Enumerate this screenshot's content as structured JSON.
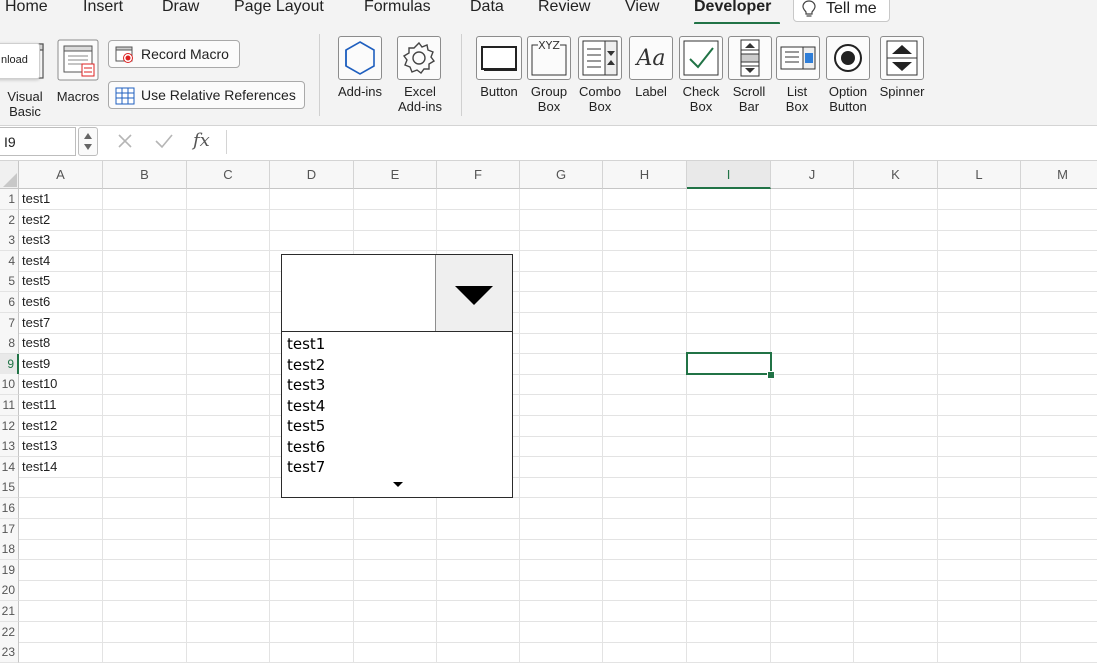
{
  "menu": {
    "tabs": [
      {
        "label": "Home",
        "active": false
      },
      {
        "label": "Insert",
        "active": false
      },
      {
        "label": "Draw",
        "active": false
      },
      {
        "label": "Page Layout",
        "active": false
      },
      {
        "label": "Formulas",
        "active": false
      },
      {
        "label": "Data",
        "active": false
      },
      {
        "label": "Review",
        "active": false
      },
      {
        "label": "View",
        "active": false
      },
      {
        "label": "Developer",
        "active": true
      }
    ],
    "tell_me": "Tell me"
  },
  "tooltip_text": "nload",
  "ribbon": {
    "visual_basic": "Visual\nBasic",
    "macros": "Macros",
    "record_macro": "Record Macro",
    "use_relative_references": "Use Relative References",
    "add_ins": "Add-ins",
    "excel_add_ins": "Excel\nAdd-ins",
    "button": "Button",
    "group_box": "Group\nBox",
    "combo_box": "Combo\nBox",
    "label": "Label",
    "check_box": "Check\nBox",
    "scroll_bar": "Scroll\nBar",
    "list_box": "List\nBox",
    "option_button": "Option\nButton",
    "spinner": "Spinner",
    "group_box_icon_text": "XYZ",
    "label_icon_text": "Aa"
  },
  "formula_bar": {
    "name_box": "I9",
    "fx": "fx",
    "formula": ""
  },
  "sheet": {
    "columns": [
      "A",
      "B",
      "C",
      "D",
      "E",
      "F",
      "G",
      "H",
      "I",
      "J",
      "K",
      "L",
      "M"
    ],
    "selected_column": "I",
    "selected_row": "9",
    "rows": [
      "1",
      "2",
      "3",
      "4",
      "5",
      "6",
      "7",
      "8",
      "9",
      "10",
      "11",
      "12",
      "13",
      "14",
      "15",
      "16",
      "17",
      "18",
      "19",
      "20",
      "21",
      "22",
      "23"
    ],
    "column_a_values": [
      "test1",
      "test2",
      "test3",
      "test4",
      "test5",
      "test6",
      "test7",
      "test8",
      "test9",
      "test10",
      "test11",
      "test12",
      "test13",
      "test14"
    ]
  },
  "combo_control": {
    "current_value": "",
    "list_items": [
      "test1",
      "test2",
      "test3",
      "test4",
      "test5",
      "test6",
      "test7"
    ]
  },
  "colors": {
    "accent": "#217346"
  }
}
